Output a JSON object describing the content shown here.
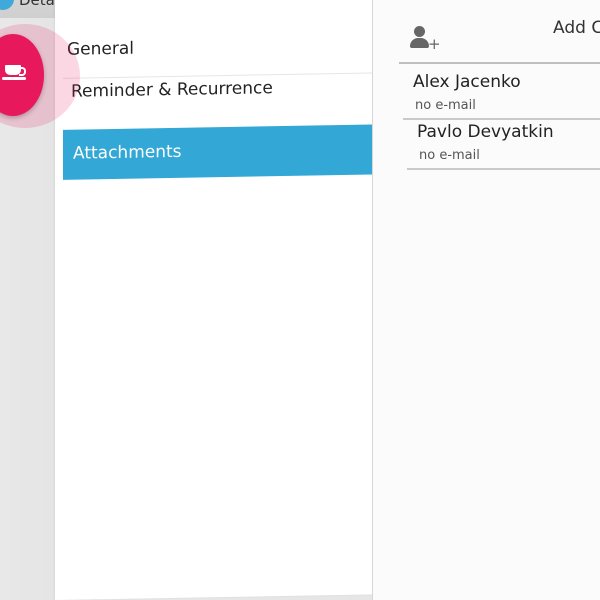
{
  "window": {
    "title": "Deta"
  },
  "menu": {
    "items": [
      {
        "label": "General"
      },
      {
        "label": "Reminder & Recurrence"
      },
      {
        "label": "Attachments",
        "selected": true
      }
    ]
  },
  "contacts": {
    "add_label": "Add Co",
    "list": [
      {
        "name": "Alex Jacenko",
        "email": "no e-mail"
      },
      {
        "name": "Pavlo Devyatkin",
        "email": "no e-mail"
      }
    ]
  },
  "fab": {
    "icon": "coffee-cup-icon",
    "color": "#e8185c"
  },
  "colors": {
    "selected_item": "#33a8d6"
  }
}
